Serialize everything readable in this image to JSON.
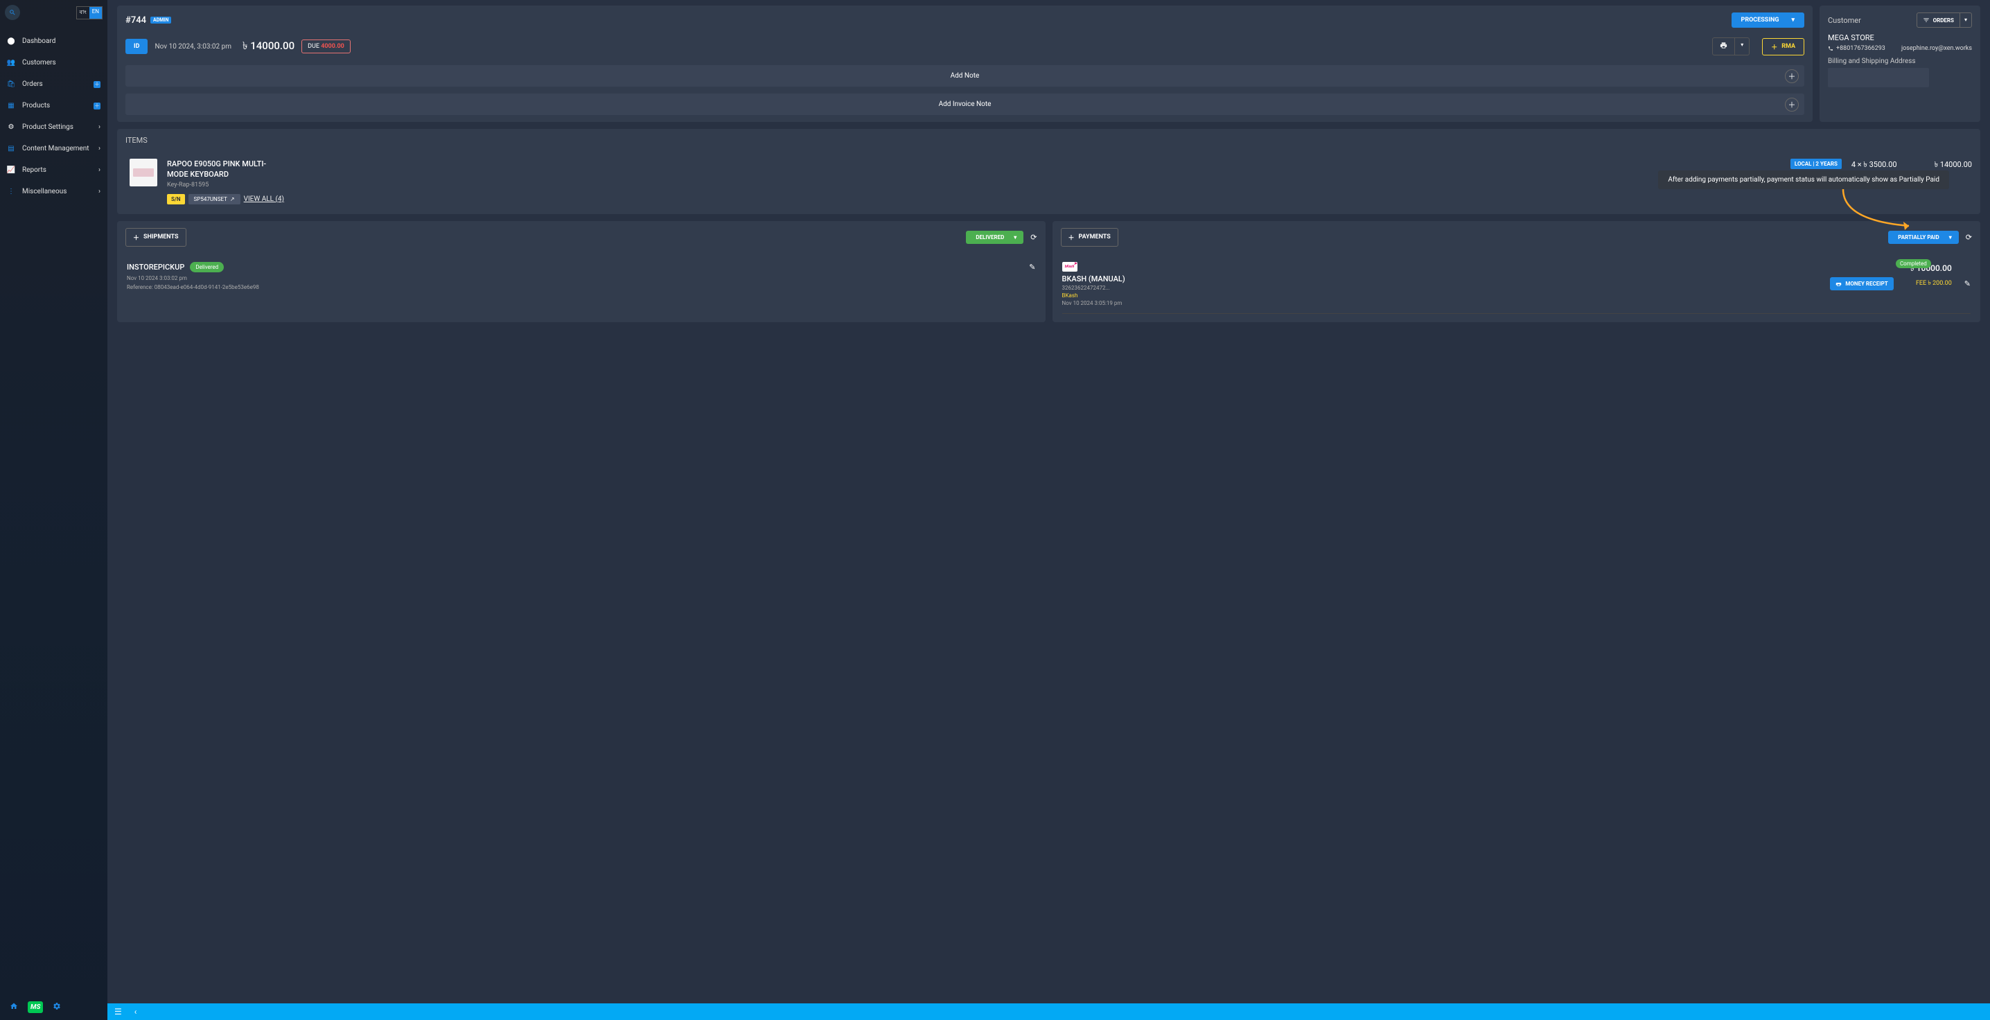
{
  "sidebar": {
    "lang_inactive": "বাং",
    "lang_active": "EN",
    "items": [
      {
        "icon": "⬤",
        "label": "Dashboard",
        "has_chev": false,
        "has_plus": false,
        "color": "#fff"
      },
      {
        "icon": "👥",
        "label": "Customers",
        "has_chev": false,
        "has_plus": false,
        "color": "#1e88e5"
      },
      {
        "icon": "🛍",
        "label": "Orders",
        "has_chev": false,
        "has_plus": true,
        "color": "#1e88e5"
      },
      {
        "icon": "▦",
        "label": "Products",
        "has_chev": false,
        "has_plus": true,
        "color": "#1e88e5"
      },
      {
        "icon": "⚙",
        "label": "Product Settings",
        "has_chev": true,
        "has_plus": false,
        "color": "#fff"
      },
      {
        "icon": "▤",
        "label": "Content Management",
        "has_chev": true,
        "has_plus": false,
        "color": "#1e88e5"
      },
      {
        "icon": "📈",
        "label": "Reports",
        "has_chev": true,
        "has_plus": false,
        "color": "#1e88e5"
      },
      {
        "icon": "⋮",
        "label": "Miscellaneous",
        "has_chev": true,
        "has_plus": false,
        "color": "#1e88e5"
      }
    ],
    "ms_badge": "MS"
  },
  "order": {
    "id": "#744",
    "admin_badge": "ADMIN",
    "status_btn": "PROCESSING",
    "id_btn": "ID",
    "date": "Nov 10 2024, 3:03:02 pm",
    "currency": "৳",
    "total": "14000.00",
    "due_label": "DUE",
    "due_amount": "4000.00",
    "rma": "RMA",
    "add_note": "Add Note",
    "add_invoice_note": "Add Invoice Note"
  },
  "customer": {
    "title": "Customer",
    "orders_btn": "ORDERS",
    "name": "MEGA STORE",
    "phone": "+8801767366293",
    "email": "josephine.roy@xen.works",
    "billing_label": "Billing and Shipping Address"
  },
  "items": {
    "title": "ITEMS",
    "product_name": "RAPOO E9050G PINK MULTI-MODE KEYBOARD",
    "sku": "Key-Rap-81595",
    "sn": "S/N",
    "sp": "SP547UNSET",
    "view_all": "VIEW ALL (4)",
    "local_badge": "LOCAL | 2 YEARS",
    "qty_price": "4 × ৳ 3500.00",
    "line_total": "৳ 14000.00"
  },
  "annotation": "After adding payments partially, payment status will automatically show as Partially Paid",
  "shipments": {
    "add_btn": "SHIPMENTS",
    "status": "DELIVERED",
    "method": "INSTOREPICKUP",
    "pill": "Delivered",
    "time": "Nov 10 2024 3:03:02 pm",
    "ref": "Reference: 08043ead-e064-4d0d-9141-2e5be53e6e98"
  },
  "payments": {
    "add_btn": "PAYMENTS",
    "status": "PARTIALLY PAID",
    "bkash": "bKash",
    "method": "BKASH (MANUAL)",
    "ref": "32623622472472...",
    "src": "BKash",
    "time": "Nov 10 2024 3:05:19 pm",
    "money_receipt": "MONEY RECEIPT",
    "completed": "Completed",
    "amount": "৳ 10000.00",
    "fee": "FEE ৳ 200.00"
  }
}
